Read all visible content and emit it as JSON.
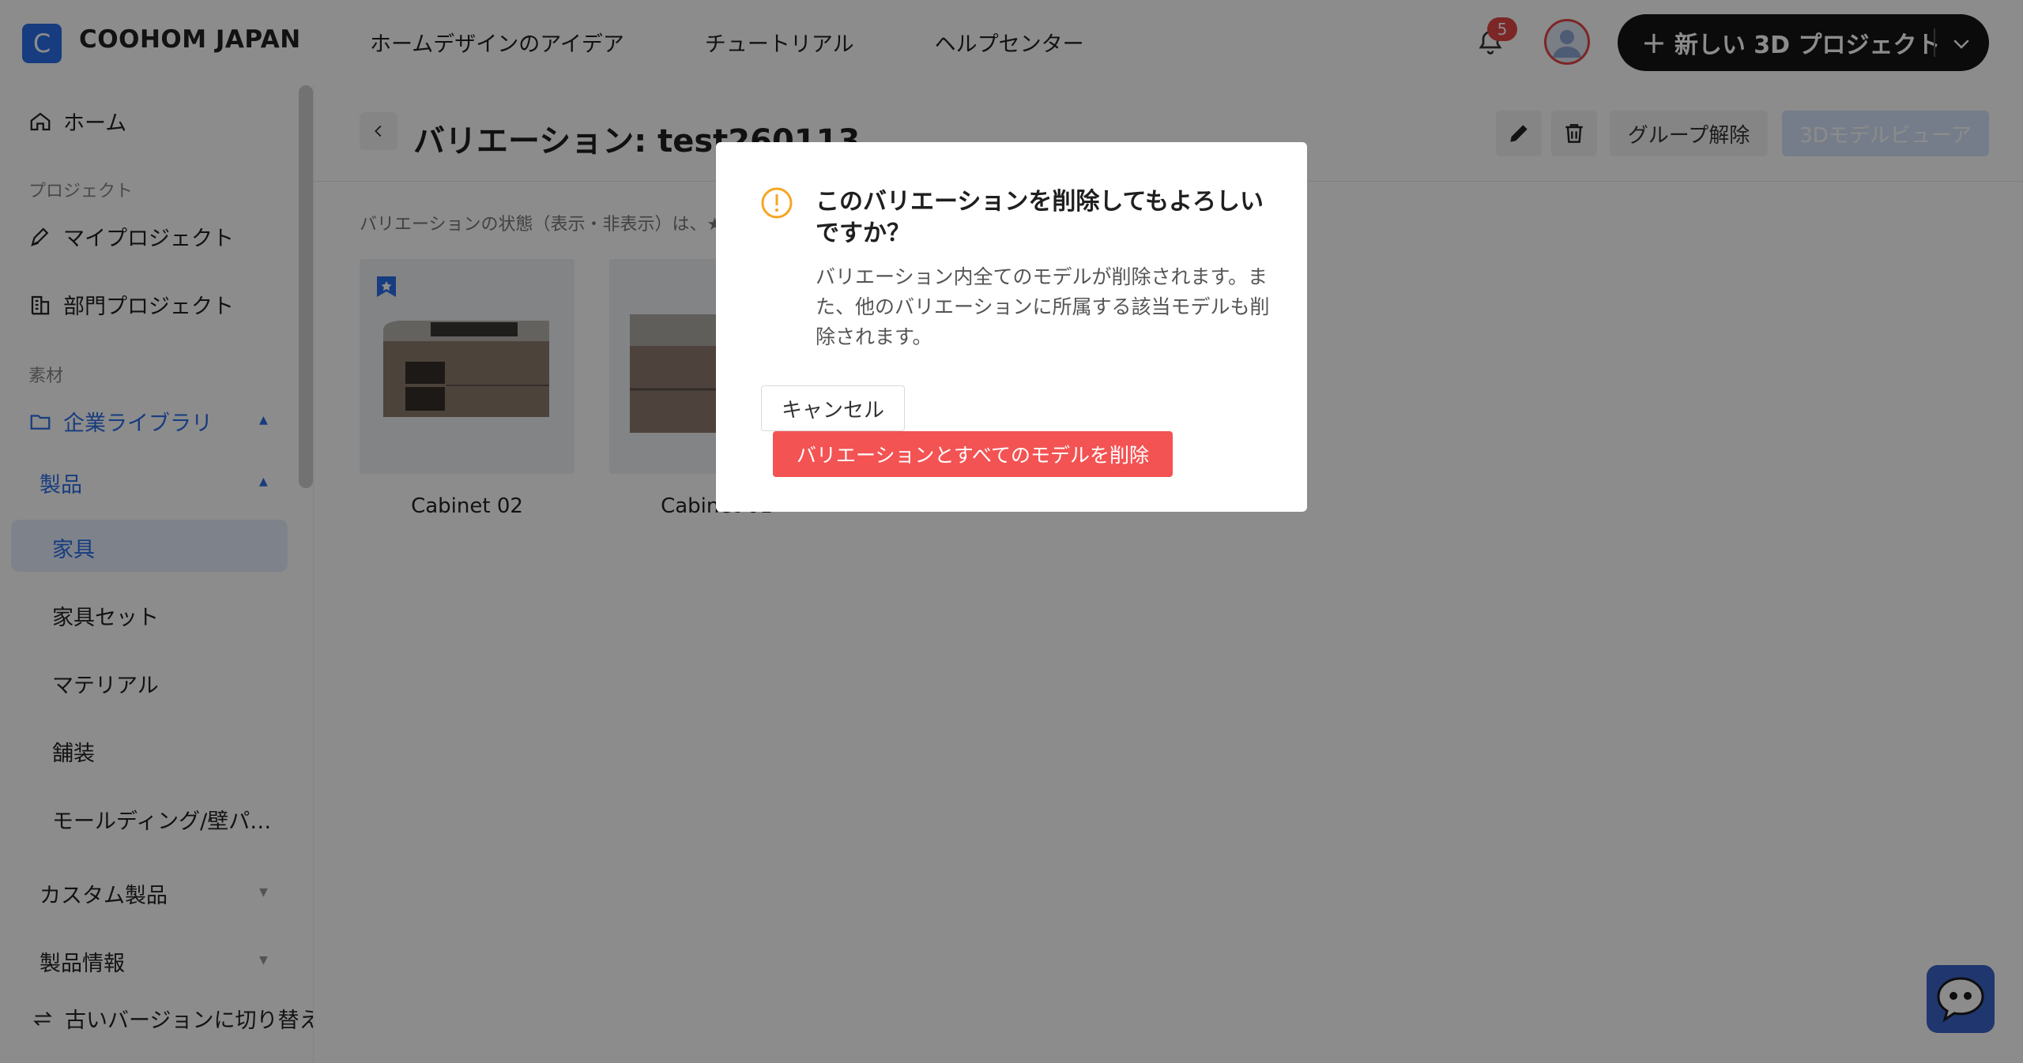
{
  "app": {
    "logo_letter": "C",
    "brand": "COOHOM JAPAN"
  },
  "header": {
    "nav": [
      {
        "label": "ホームデザインのアイデア"
      },
      {
        "label": "チュートリアル"
      },
      {
        "label": "ヘルプセンター"
      }
    ],
    "notification_count": "5",
    "new_project_label": "新しい 3D プロジェクト"
  },
  "sidebar": {
    "home": "ホーム",
    "section_projects": "プロジェクト",
    "my_projects": "マイプロジェクト",
    "dept_projects": "部門プロジェクト",
    "section_materials": "素材",
    "enterprise_library": "企業ライブラリ",
    "products": "製品",
    "furniture": "家具",
    "furniture_set": "家具セット",
    "material": "マテリアル",
    "paving": "舗装",
    "molding": "モールディング/壁パ…",
    "custom_products": "カスタム製品",
    "product_info": "製品情報",
    "switch_old": "古いバージョンに切り替え"
  },
  "main": {
    "title": "バリエーション: test260113",
    "ungroup_label": "グループ解除",
    "viewer_label": "3Dモデルビューア",
    "hint": "バリエーションの状態（表示・非表示）は、★",
    "cards": [
      {
        "name": "Cabinet 02"
      },
      {
        "name": "Cabinet 01"
      }
    ]
  },
  "modal": {
    "title": "このバリエーションを削除してもよろしいですか？",
    "body": "バリエーション内全てのモデルが削除されます。また、他のバリエーションに所属する該当モデルも削除されます。",
    "cancel_label": "キャンセル",
    "delete_label": "バリエーションとすべてのモデルを削除"
  },
  "colors": {
    "accent": "#2b6de8",
    "danger": "#f35353",
    "warning": "#f5a623"
  }
}
